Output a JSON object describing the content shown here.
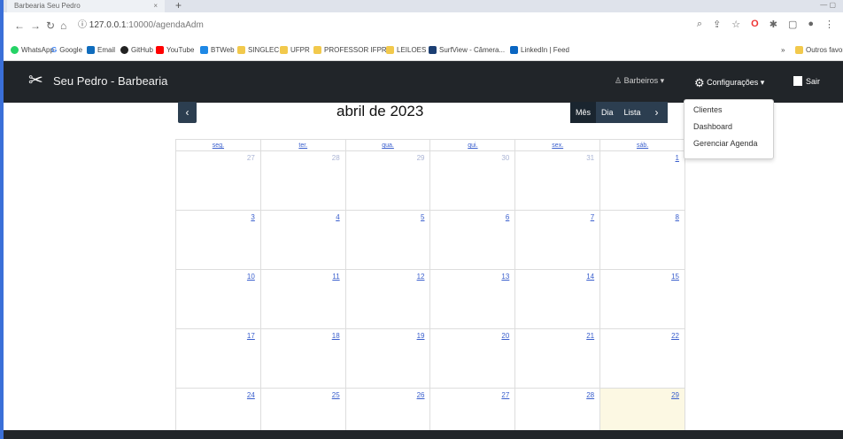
{
  "browser": {
    "tab_title": "Barbearia Seu Pedro",
    "tab_close": "×",
    "new_tab": "+",
    "window_controls": "—   ▢",
    "url_host": "127.0.0.1",
    "url_rest": ":10000/agendaAdm",
    "bookmarks": [
      "WhatsApp",
      "Google",
      "Email",
      "GitHub",
      "YouTube",
      "BTWeb",
      "SINGLEC",
      "UFPR",
      "PROFESSOR IFPR",
      "LEILOES",
      "SurfView - Câmera...",
      "LinkedIn | Feed"
    ],
    "bookmarks_more": "»",
    "other_favorites": "Outros favoritos"
  },
  "navbar": {
    "brand": "Seu Pedro - Barbearia",
    "barbeiros": "Barbeiros",
    "configuracoes": "Configurações",
    "sair": "Sair"
  },
  "dropdown": {
    "items": [
      "Clientes",
      "Dashboard",
      "Gerenciar Agenda"
    ]
  },
  "calendar": {
    "title": "abril de 2023",
    "prev": "‹",
    "next": "›",
    "views": [
      "Mês",
      "Dia",
      "Lista"
    ],
    "weekdays": [
      "seg.",
      "ter.",
      "qua.",
      "qui.",
      "sex.",
      "sáb."
    ],
    "weeks": [
      [
        "27",
        "28",
        "29",
        "30",
        "31",
        "1"
      ],
      [
        "3",
        "4",
        "5",
        "6",
        "7",
        "8"
      ],
      [
        "10",
        "11",
        "12",
        "13",
        "14",
        "15"
      ],
      [
        "17",
        "18",
        "19",
        "20",
        "21",
        "22"
      ],
      [
        "24",
        "25",
        "26",
        "27",
        "28",
        "29"
      ]
    ]
  },
  "colors": {
    "navbar": "#212529",
    "button": "#2c3e50",
    "today": "#fcf8e3",
    "link": "#3a5fcd"
  }
}
